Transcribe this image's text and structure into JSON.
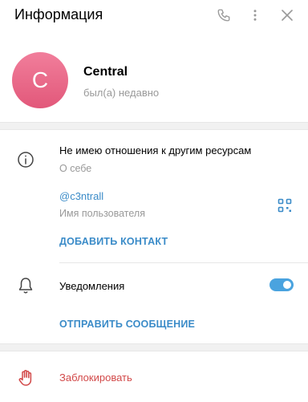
{
  "header": {
    "title": "Информация"
  },
  "profile": {
    "avatar_letter": "C",
    "name": "Central",
    "status": "был(а) недавно",
    "avatar_color": "#e8647f"
  },
  "info": {
    "bio": "Не имею отношения к другим ресурсам",
    "bio_label": "О себе",
    "username": "@c3ntrall",
    "username_label": "Имя пользователя",
    "add_contact": "ДОБАВИТЬ КОНТАКТ"
  },
  "notifications": {
    "label": "Уведомления",
    "enabled": true,
    "send_message": "ОТПРАВИТЬ СООБЩЕНИЕ"
  },
  "block": {
    "label": "Заблокировать",
    "color": "#d24949"
  },
  "colors": {
    "accent": "#3a8bc8",
    "toggle_on": "#4aa3df",
    "danger": "#d24949"
  }
}
